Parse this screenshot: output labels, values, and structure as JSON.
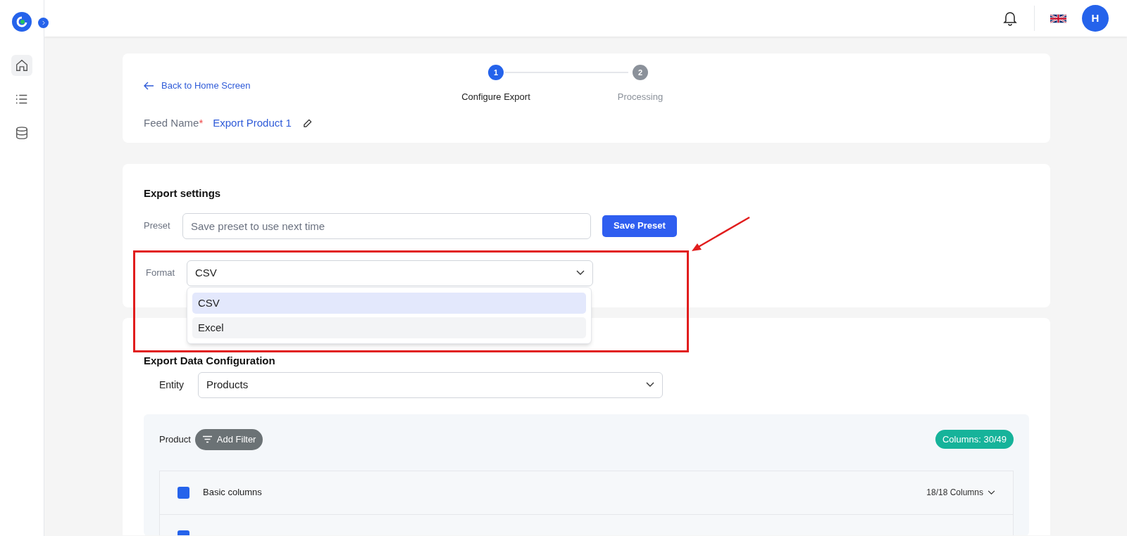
{
  "topbar": {
    "avatar": "H"
  },
  "sidebar": {
    "items": [
      {
        "selected": true
      },
      {
        "selected": false
      },
      {
        "selected": false
      }
    ]
  },
  "header": {
    "back_link": "Back to Home Screen",
    "steps": [
      {
        "number": "1",
        "label": "Configure Export",
        "active": true
      },
      {
        "number": "2",
        "label": "Processing",
        "active": false
      }
    ],
    "feed_name_label": "Feed Name",
    "feed_name_required": "*",
    "feed_name": "Export Product 1"
  },
  "export_settings": {
    "title": "Export settings",
    "preset_label": "Preset",
    "preset_placeholder": "Save preset to use next time",
    "save_button": "Save Preset",
    "format_label": "Format",
    "format_value": "CSV",
    "format_options": [
      {
        "label": "CSV",
        "selected": true
      },
      {
        "label": "Excel",
        "selected": false
      }
    ]
  },
  "data_configuration": {
    "title": "Export Data Configuration",
    "entity_label": "Entity",
    "entity_value": "Products",
    "product_label": "Product",
    "add_filter": "Add Filter",
    "columns_badge": "Columns: 30/49",
    "groups": [
      {
        "label": "Basic columns",
        "checked": true,
        "count": "18/18 Columns"
      },
      {
        "checked": true
      }
    ]
  }
}
